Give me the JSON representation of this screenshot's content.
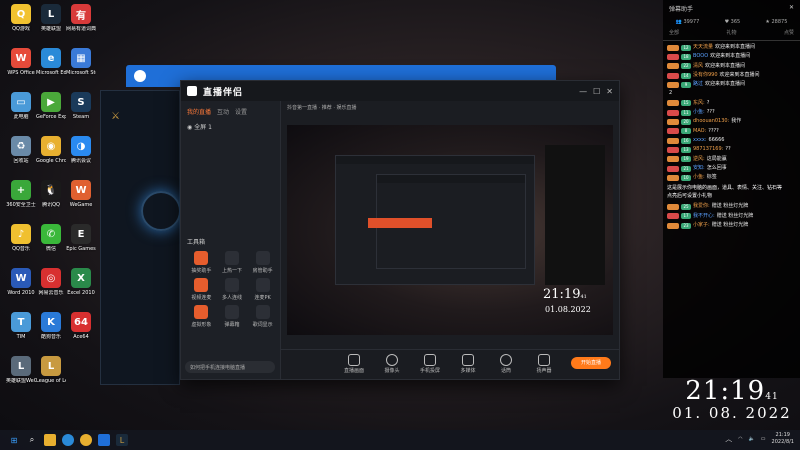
{
  "desktop": {
    "icons": [
      {
        "label": "QQ游戏",
        "color": "#f2c230",
        "glyph": "Q"
      },
      {
        "label": "英雄联盟",
        "color": "#1a2a3a",
        "glyph": "L"
      },
      {
        "label": "网易有道词典",
        "color": "#d83a3a",
        "glyph": "有"
      },
      {
        "label": "WPS Office",
        "color": "#e64a3a",
        "glyph": "W"
      },
      {
        "label": "Microsoft Edge",
        "color": "#2a8ad8",
        "glyph": "e"
      },
      {
        "label": "Microsoft Store",
        "color": "#3a7ad8",
        "glyph": "▦"
      },
      {
        "label": "此电脑",
        "color": "#4a9ad8",
        "glyph": "▭"
      },
      {
        "label": "GeForce Experience",
        "color": "#4aa83a",
        "glyph": "▶"
      },
      {
        "label": "Steam",
        "color": "#1a3a5a",
        "glyph": "S"
      },
      {
        "label": "回收站",
        "color": "#6a8aa8",
        "glyph": "♻"
      },
      {
        "label": "Google Chrome",
        "color": "#e8b030",
        "glyph": "◉"
      },
      {
        "label": "腾讯会议",
        "color": "#2a8af0",
        "glyph": "◑"
      },
      {
        "label": "360安全卫士",
        "color": "#3aa83a",
        "glyph": "+"
      },
      {
        "label": "腾讯QQ",
        "color": "#1a1a1a",
        "glyph": "🐧"
      },
      {
        "label": "WeGame",
        "color": "#e06030",
        "glyph": "W"
      },
      {
        "label": "QQ音乐",
        "color": "#f0c030",
        "glyph": "♪"
      },
      {
        "label": "微信",
        "color": "#3ab83a",
        "glyph": "✆"
      },
      {
        "label": "Epic Games",
        "color": "#2a2a2a",
        "glyph": "E"
      },
      {
        "label": "Word 2010",
        "color": "#2a5ab8",
        "glyph": "W"
      },
      {
        "label": "网易云音乐",
        "color": "#d83030",
        "glyph": "◎"
      },
      {
        "label": "Excel 2010",
        "color": "#2a8a4a",
        "glyph": "X"
      },
      {
        "label": "TIM",
        "color": "#4a9ad8",
        "glyph": "T"
      },
      {
        "label": "酷狗音乐",
        "color": "#2a7ad8",
        "glyph": "K"
      },
      {
        "label": "Ace64",
        "color": "#d83030",
        "glyph": "64"
      },
      {
        "label": "英雄联盟WeGame版",
        "color": "#5a6a7a",
        "glyph": "L"
      },
      {
        "label": "League of Legends",
        "color": "#c89a40",
        "glyph": "L"
      }
    ]
  },
  "main_app": {
    "logo": "直播伴侣",
    "side_tabs": [
      "我的直播",
      "互动",
      "设置"
    ],
    "scene_label": "全屏 1",
    "tools_header": "工具箱",
    "tools": [
      "抽奖助手",
      "上热一下",
      "房管助手",
      "视频连麦",
      "多人连线",
      "连麦PK",
      "虚拟形象",
      "弹幕箱",
      "歌词显示"
    ],
    "notice": "如何把手机连接电脑直播",
    "preview_meta": "抖音第一直播 · 推荐 · 娱乐直播",
    "bottom_buttons": [
      "直播画面",
      "摄像头",
      "手机投屏",
      "多媒体",
      "话筒",
      "扬声器"
    ],
    "start_live": "开始直播"
  },
  "preview_clock": {
    "time": "21:19",
    "seconds": "41",
    "date": "01.08.2022"
  },
  "chat": {
    "title": "弹幕助手",
    "stats": [
      "39977",
      "365",
      "28875"
    ],
    "tabs": [
      "全部",
      "礼物",
      "点赞"
    ],
    "messages": [
      {
        "level": "12",
        "nick": "天天流量",
        "text": "欢迎来到本直播间"
      },
      {
        "level": "18",
        "nick": "BOOO",
        "text": "欢迎来到本直播间"
      },
      {
        "level": "22",
        "nick": "清风",
        "text": "欢迎来到本直播间"
      },
      {
        "level": "14",
        "nick": "没有你990",
        "text": "欢迎来到本直播间"
      },
      {
        "level": "9",
        "nick": "路过",
        "text": "欢迎来到本直播间"
      },
      {
        "level": "",
        "nick": "",
        "text": "2"
      },
      {
        "level": "15",
        "nick": "东风:",
        "text": "?"
      },
      {
        "level": "11",
        "nick": "小鱼:",
        "text": "???"
      },
      {
        "level": "20",
        "nick": "dhoouan0130:",
        "text": "我作"
      },
      {
        "level": "8",
        "nick": "MAO:",
        "text": "????"
      },
      {
        "level": "16",
        "nick": "xxxx:",
        "text": "66666"
      },
      {
        "level": "13",
        "nick": "987137169:",
        "text": "??"
      },
      {
        "level": "19",
        "nick": "逆风:",
        "text": "这局能赢"
      },
      {
        "level": "21",
        "nick": "安知:",
        "text": "怎么回事"
      },
      {
        "level": "10",
        "nick": "小鱼:",
        "text": "标签"
      }
    ],
    "system_text": "这是展示你电脑的画面，道具、表情、关注、钻石等",
    "system_text2": "点亮后可设置小礼物",
    "gifts": [
      {
        "level": "25",
        "nick": "我爱你:",
        "text": "赠送 粉丝灯光牌"
      },
      {
        "level": "17",
        "nick": "我不开心:",
        "text": "赠送 粉丝灯光牌"
      },
      {
        "level": "23",
        "nick": "小家子:",
        "text": "赠送 粉丝灯光牌"
      }
    ]
  },
  "big_clock": {
    "time": "21:19",
    "seconds": "41",
    "date": "01. 08. 2022"
  },
  "taskbar": {
    "tray_time": "21:19",
    "tray_date": "2022/8/1"
  }
}
